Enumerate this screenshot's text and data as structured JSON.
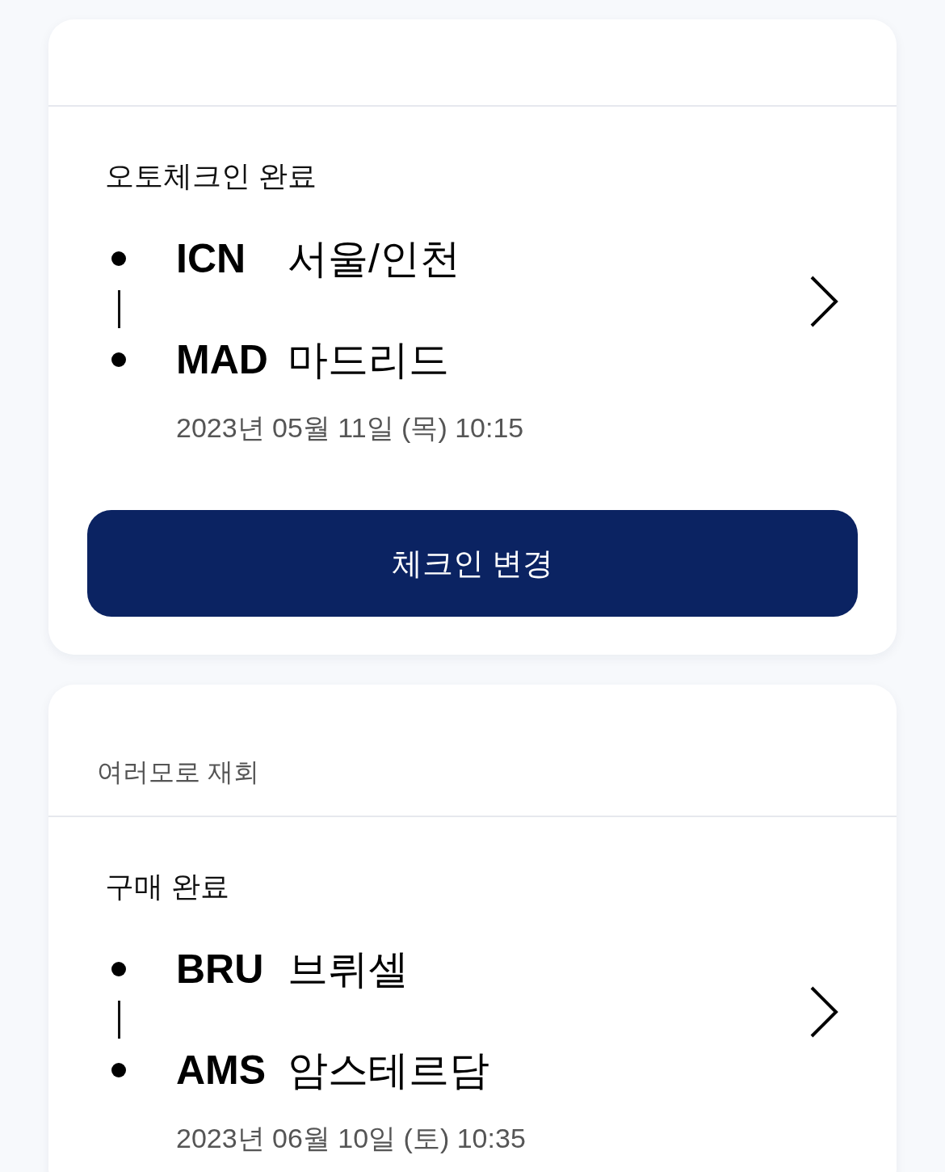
{
  "cards": [
    {
      "status": "오토체크인 완료",
      "route": [
        {
          "code": "ICN",
          "city": "서울/인천"
        },
        {
          "code": "MAD",
          "city": "마드리드"
        }
      ],
      "date": "2023년 05월 11일 (목) 10:15",
      "button": "체크인 변경"
    },
    {
      "subtitle": "여러모로 재회",
      "status": "구매 완료",
      "route": [
        {
          "code": "BRU",
          "city": "브뤼셀"
        },
        {
          "code": "AMS",
          "city": "암스테르담"
        }
      ],
      "date": "2023년 06월 10일 (토) 10:35"
    }
  ]
}
